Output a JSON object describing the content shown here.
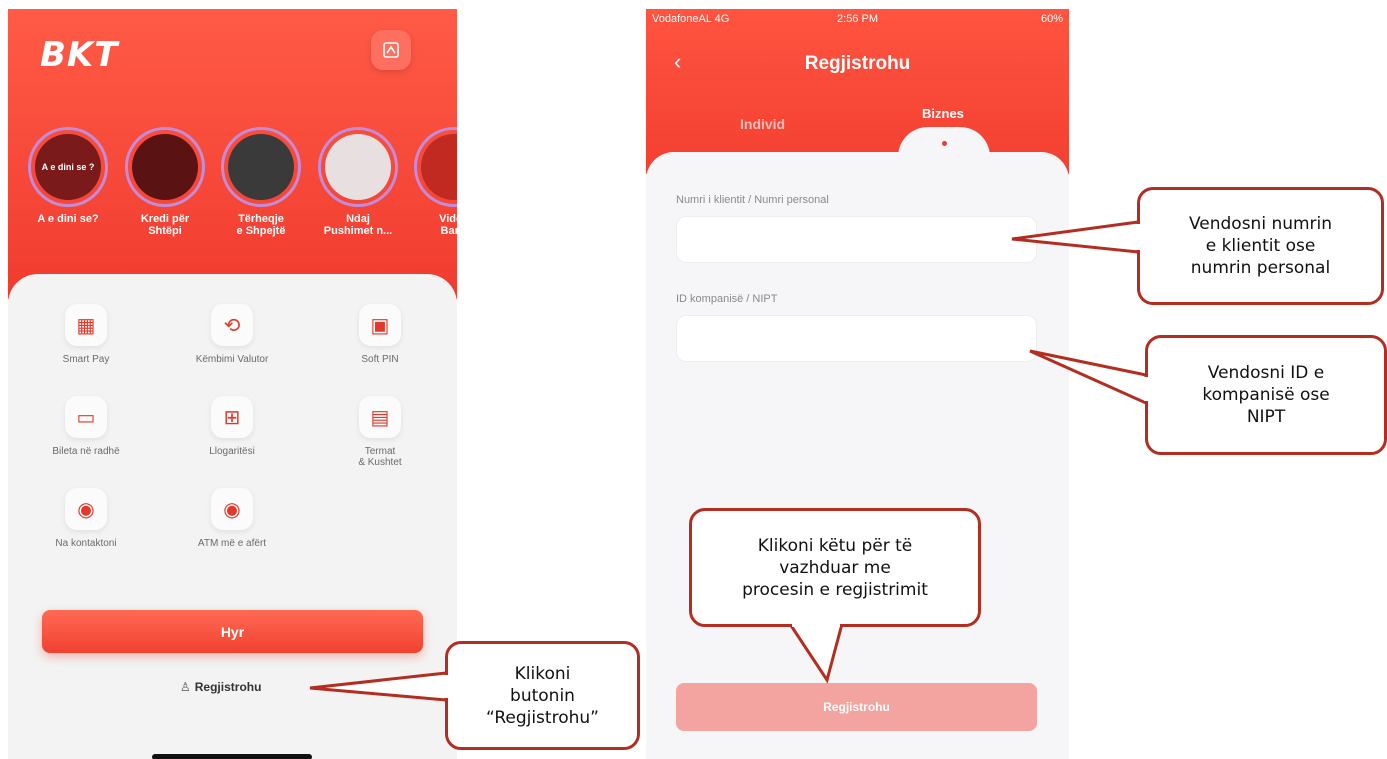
{
  "left_app": {
    "logo": "BKT",
    "stories": [
      {
        "label": "A e dini se?",
        "thumb": "A e dini se ?"
      },
      {
        "label": "Kredi për\nShtëpi",
        "thumb": ""
      },
      {
        "label": "Tërheqje\ne Shpejtë",
        "thumb": ""
      },
      {
        "label": "Ndaj\nPushimet n...",
        "thumb": ""
      },
      {
        "label": "Video\nBank",
        "thumb": ""
      }
    ],
    "tiles": [
      {
        "label": "Smart Pay",
        "icon": "qr-code-icon"
      },
      {
        "label": "Këmbimi Valutor",
        "icon": "exchange-icon"
      },
      {
        "label": "Soft PIN",
        "icon": "card-phone-icon"
      },
      {
        "label": "Bileta në radhë",
        "icon": "ticket-icon"
      },
      {
        "label": "Llogaritësi",
        "icon": "calculator-icon"
      },
      {
        "label": "Termat\n& Kushtet",
        "icon": "document-icon"
      },
      {
        "label": "Na kontaktoni",
        "icon": "location-pin-icon"
      },
      {
        "label": "ATM më e afërt",
        "icon": "atm-pin-icon"
      }
    ],
    "login_button": "Hyr",
    "register_link": "Regjistrohu"
  },
  "right_app": {
    "status": {
      "carrier": "VodafoneAL 4G",
      "time": "2:56 PM",
      "battery": "60%"
    },
    "title": "Regjistrohu",
    "tabs": [
      "Individ",
      "Biznes"
    ],
    "active_tab": "Biznes",
    "fields": [
      {
        "label": "Numri i klientit / Numri personal",
        "value": ""
      },
      {
        "label": "ID kompanisë / NIPT",
        "value": ""
      }
    ],
    "submit_button": "Regjistrohu"
  },
  "callouts": {
    "register_hint": "Klikoni\nbutonin\n“Regjistrohu”",
    "client_number_hint": "Vendosni numrin\ne klientit ose\nnumrin personal",
    "company_id_hint": "Vendosni ID e\nkompanisë ose\nNIPT",
    "continue_hint": "Klikoni këtu për të\nvazhduar me\nprocesin e regjistrimit"
  },
  "colors": {
    "brand_red": "#f03b2f",
    "callout_border": "#b32d20"
  }
}
